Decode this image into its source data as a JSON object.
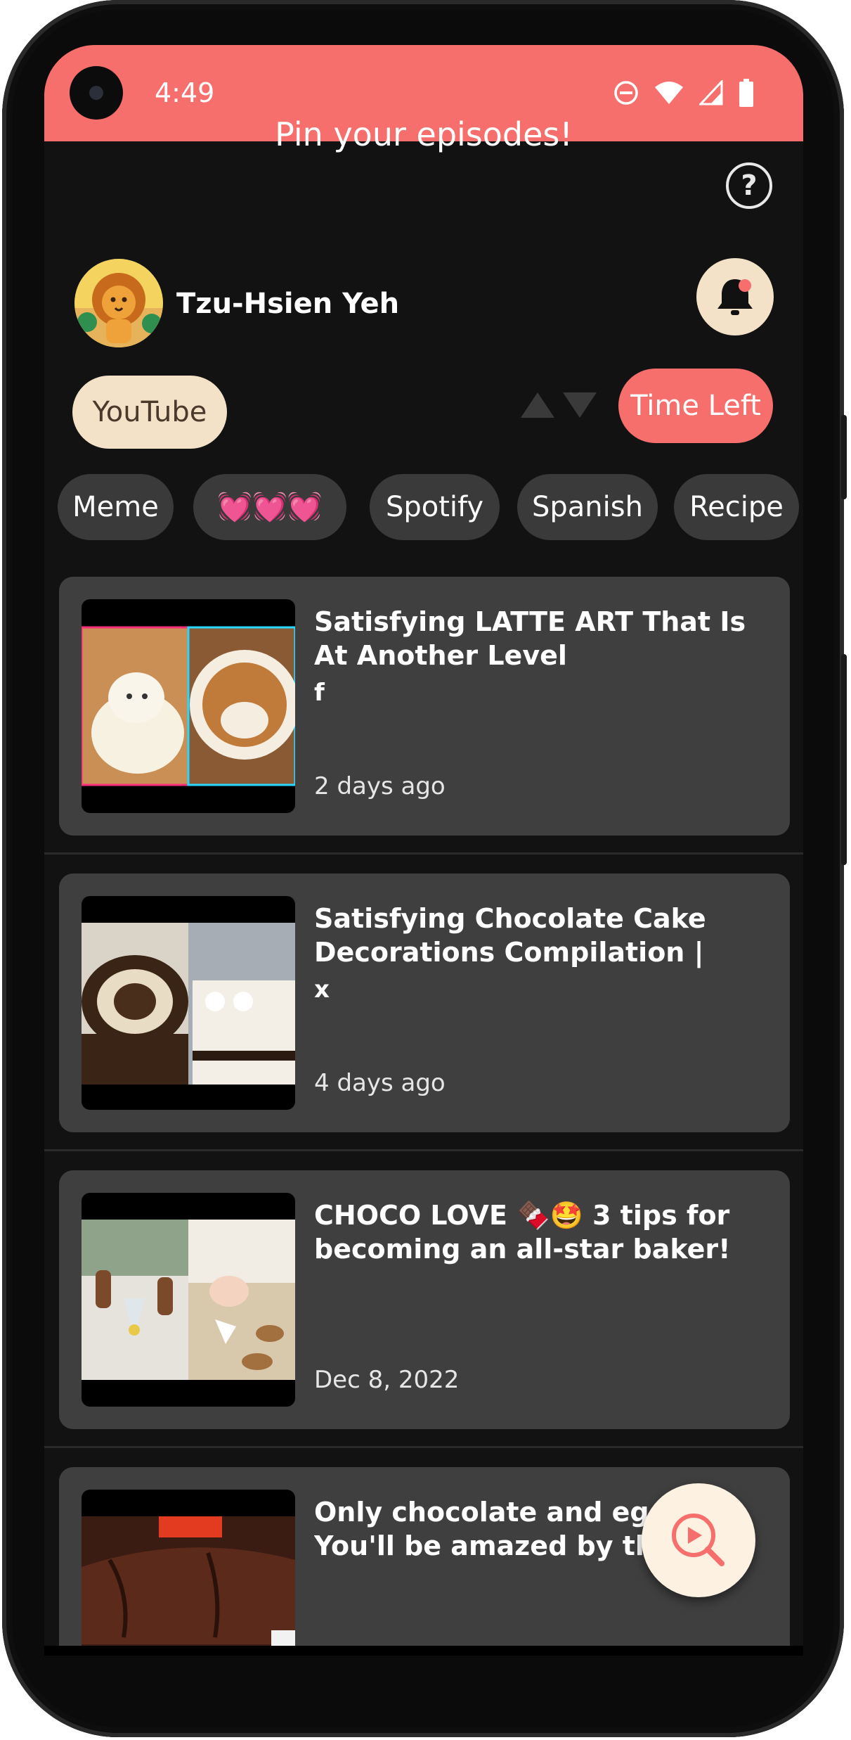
{
  "status_bar": {
    "time": "4:49"
  },
  "header": {
    "title": "Pin your episodes!"
  },
  "user": {
    "name": "Tzu-Hsien Yeh"
  },
  "filters": {
    "source": "YouTube",
    "sort": "Time Left",
    "tags": [
      "Meme",
      "💓💓💓",
      "Spotify",
      "Spanish",
      "Recipe"
    ]
  },
  "episodes": [
    {
      "title": "Satisfying LATTE ART That Is At Another Level",
      "note": "f",
      "date": "2 days ago"
    },
    {
      "title": "Satisfying Chocolate Cake Decorations Compilation | Amazi...",
      "note": "x",
      "date": "4 days ago"
    },
    {
      "title": "CHOCO LOVE 🍫🤩 3 tips for becoming an all-star baker!",
      "note": "",
      "date": "Dec 8, 2022"
    },
    {
      "title": "Only chocolate and eggs! You'll be amazed by this dessert",
      "note": "",
      "date": ""
    }
  ],
  "colors": {
    "accent": "#f76f6c",
    "cream": "#f3e2c8",
    "card": "#3f3f3f",
    "background": "#121212"
  },
  "icons": {
    "help": "question-circle-icon",
    "notification": "bell-icon",
    "search_play": "search-play-icon"
  }
}
